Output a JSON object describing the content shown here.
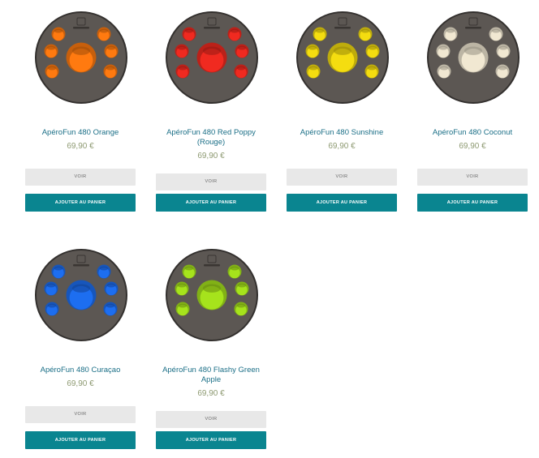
{
  "products": [
    {
      "name": "ApéroFun 480 Orange",
      "price": "69,90 €",
      "view_label": "VOIR",
      "cart_label": "AJOUTER AU PANIER",
      "accent": "#ff7a10"
    },
    {
      "name": "ApéroFun 480 Red Poppy (Rouge)",
      "price": "69,90 €",
      "view_label": "VOIR",
      "cart_label": "AJOUTER AU PANIER",
      "accent": "#f02a20"
    },
    {
      "name": "ApéroFun 480 Sunshine",
      "price": "69,90 €",
      "view_label": "VOIR",
      "cart_label": "AJOUTER AU PANIER",
      "accent": "#f4dd10"
    },
    {
      "name": "ApéroFun 480 Coconut",
      "price": "69,90 €",
      "view_label": "VOIR",
      "cart_label": "AJOUTER AU PANIER",
      "accent": "#f1e8d2"
    },
    {
      "name": "ApéroFun 480 Curaçao",
      "price": "69,90 €",
      "view_label": "VOIR",
      "cart_label": "AJOUTER AU PANIER",
      "accent": "#1d6ef0"
    },
    {
      "name": "ApéroFun 480 Flashy Green Apple",
      "price": "69,90 €",
      "view_label": "VOIR",
      "cart_label": "AJOUTER AU PANIER",
      "accent": "#a6e31c"
    }
  ],
  "colors": {
    "title": "#1b6f87",
    "price": "#8e9a72",
    "button_primary": "#0a8590",
    "button_secondary": "#e8e8e8",
    "tray": "#5c5753"
  }
}
